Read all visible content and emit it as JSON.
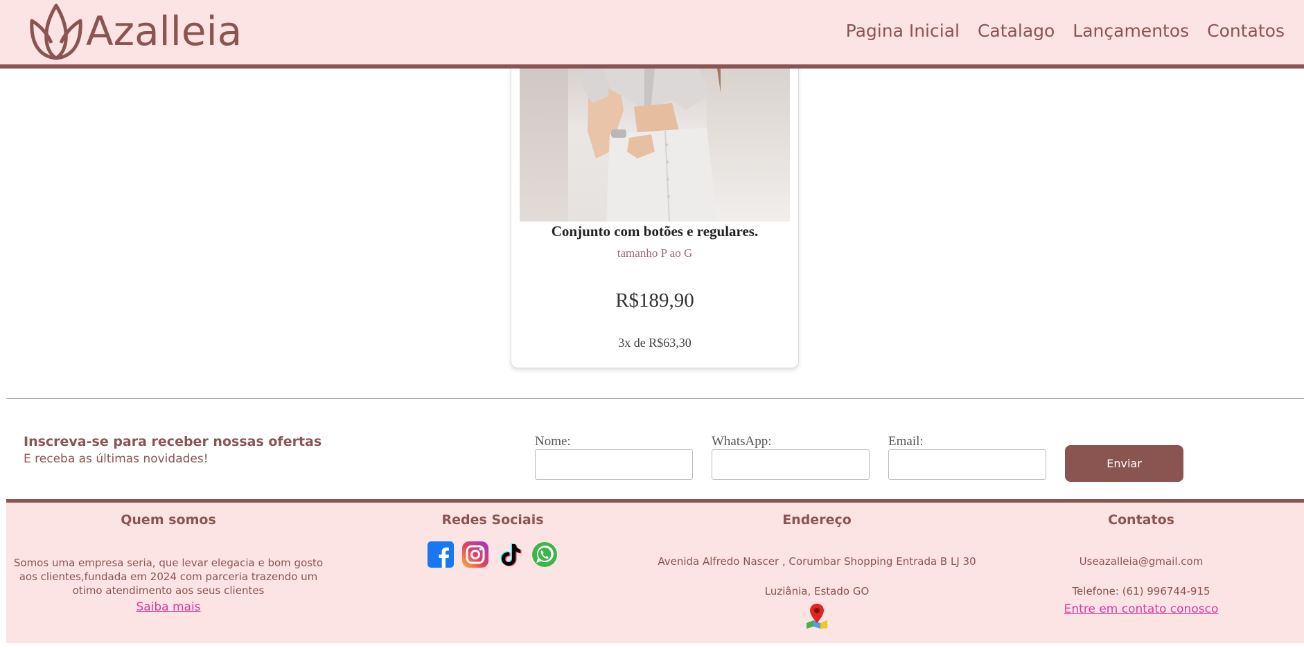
{
  "header": {
    "brand": "Azalleia",
    "nav": [
      "Pagina Inicial",
      "Catalago",
      "Lançamentos",
      "Contatos"
    ]
  },
  "product": {
    "name": "Conjunto com botões e regulares.",
    "size": "tamanho P ao G",
    "price": "R$189,90",
    "installments": "3x de R$63,30"
  },
  "newsletter": {
    "title": "Inscreva-se para receber nossas ofertas",
    "subtitle": "E receba as últimas novidades!",
    "fields": [
      {
        "label": "Nome:",
        "value": ""
      },
      {
        "label": "WhatsApp:",
        "value": ""
      },
      {
        "label": "Email:",
        "value": ""
      }
    ],
    "button": "Enviar"
  },
  "footer": {
    "about": {
      "title": "Quem somos",
      "text": "Somos uma empresa seria, que levar elegacia e bom gosto aos clientes,fundada em 2024 com parceria trazendo um otimo atendimento aos seus clientes",
      "link": "Saiba mais"
    },
    "social": {
      "title": "Redes Sociais",
      "icons": [
        "facebook-icon",
        "instagram-icon",
        "tiktok-icon",
        "whatsapp-icon"
      ]
    },
    "address": {
      "title": "Endereço",
      "line1": "Avenida Alfredo Nascer , Corumbar Shopping Entrada B LJ 30",
      "line2": "Luziânia, Estado GO",
      "icon": "map-pin-icon"
    },
    "contact": {
      "title": "Contatos",
      "email": "Useazalleia@gmail.com",
      "phone": "Telefone: (61) 996744-915",
      "link": "Entre em contato conosco"
    }
  },
  "colors": {
    "brand": "#8a5451",
    "header_bg": "#fde4e4",
    "link": "#d63aa0",
    "whatsapp": "#25d366"
  }
}
